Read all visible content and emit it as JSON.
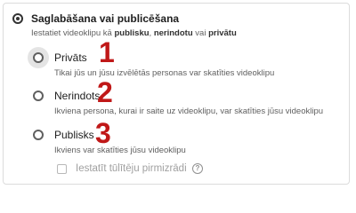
{
  "section": {
    "title": "Saglabāšana vai publicēšana",
    "subtitle_parts": [
      "Iestatiet videoklipu kā ",
      "publisku",
      ", ",
      "nerindotu",
      " vai ",
      "privātu"
    ]
  },
  "options": [
    {
      "label": "Privāts",
      "description": "Tikai jūs un jūsu izvēlētās personas var skatīties videoklipu",
      "number": "1"
    },
    {
      "label": "Nerindots",
      "description": "Ikviena persona, kurai ir saite uz videoklipu, var skatīties jūsu videoklipu",
      "number": "2"
    },
    {
      "label": "Publisks",
      "description": "Ikviens var skatīties jūsu videoklipu",
      "number": "3"
    }
  ],
  "instant_premiere": {
    "label": "Iestatīt tūlītēju pirmizrādi",
    "help": "?"
  },
  "colors": {
    "annotation": "#c01818",
    "text": "#202020",
    "muted": "#606060"
  }
}
